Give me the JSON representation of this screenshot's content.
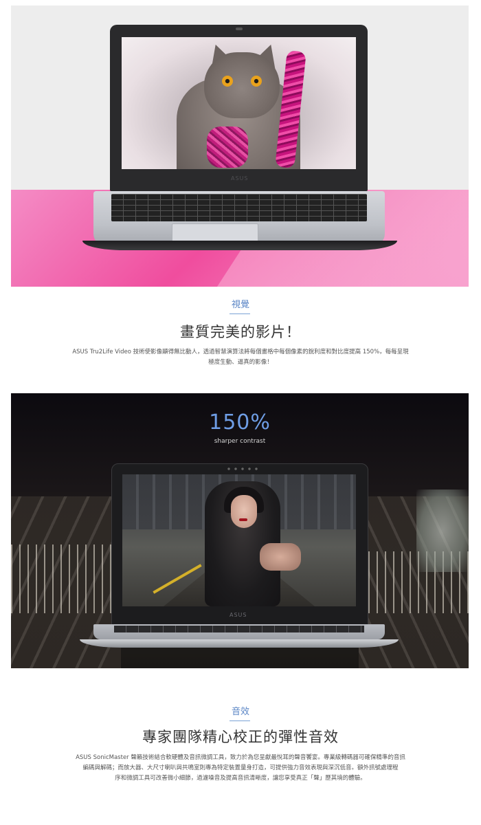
{
  "hero1": {
    "laptop_brand": "ASUS",
    "colors": {
      "background": "#ededed",
      "accent_pink": "#f26fb1"
    },
    "screen_subject": "cat with pink tinsel"
  },
  "section_vision": {
    "label": "視覺",
    "title": "畫質完美的影片！",
    "description_line1": "ASUS Tru2Life Video 技術使影像顯得無比動人，透過智慧演算法將每個畫格中每個像素的銳利度和對比度提高 150%，每每呈現",
    "description_line2": "極度生動、逼真的影像！"
  },
  "hero2": {
    "stat_value": "150%",
    "stat_caption": "sharper contrast",
    "laptop_brand": "ASUS",
    "colors": {
      "stat_color": "#6f9ee6",
      "background": "#0f0d12"
    }
  },
  "section_audio": {
    "label": "音效",
    "title": "專家團隊精心校正的彈性音效",
    "description_line1": "ASUS SonicMaster 聲籟技術結合軟硬體及音訊微調工具，致力於為您呈獻最悅耳的聲音饗宴。專業級轉碼器可確保精準的音訊",
    "description_line2": "編碼與解碼；而放大器、大尺寸喇叭與共鳴室則專為特定裝置量身打造，可提供強力音效表現與深沉低音。額外訊號處理程",
    "description_line3": "序和微調工具可改善微小細節，過濾噪音及提高音訊清晰度，讓您享受真正「聲」歷其境的體驗。"
  }
}
